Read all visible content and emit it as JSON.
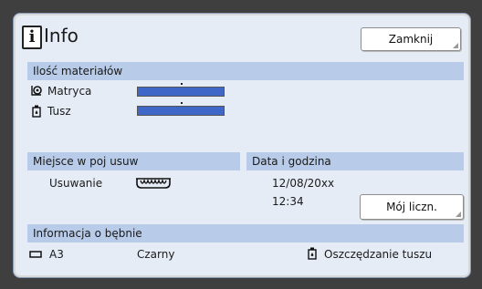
{
  "header": {
    "title": "Info",
    "close_label": "Zamknij"
  },
  "materials": {
    "header": "Ilość materiałów",
    "master_label": "Matryca",
    "ink_label": "Tusz",
    "master_level": 1.0,
    "ink_level": 1.0
  },
  "disposal": {
    "header": "Miejsce w poj usuw",
    "label": "Usuwanie"
  },
  "datetime": {
    "header": "Data i godzina",
    "date": "12/08/20xx",
    "time": "12:34",
    "counter_label": "Mój liczn."
  },
  "drum": {
    "header": "Informacja o bębnie",
    "size": "A3",
    "color": "Czarny",
    "mode": "Oszczędzanie tuszu"
  },
  "colors": {
    "panel": "#e6ecf6",
    "section_header": "#b8cbe8",
    "level_bar": "#3e67c8"
  }
}
